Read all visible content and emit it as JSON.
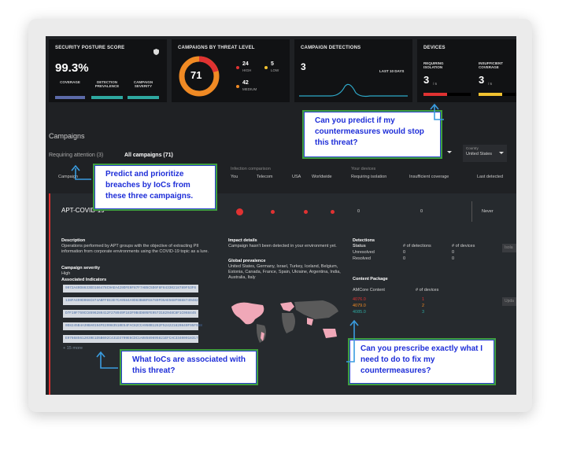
{
  "cards": {
    "posture": {
      "title": "SECURITY POSTURE SCORE",
      "value": "99.3%",
      "labels": [
        "COVERAGE",
        "DETECTION PREVALENCE",
        "CAMPAIGN SEVERITY"
      ]
    },
    "threat": {
      "title": "CAMPAIGNS BY THREAT LEVEL",
      "total": "71",
      "high": "24",
      "high_label": "HIGH",
      "low": "5",
      "low_label": "LOW",
      "medium": "42",
      "medium_label": "MEDIUM"
    },
    "detections": {
      "title": "CAMPAIGN DETECTIONS",
      "value": "3",
      "period": "LAST 10 DAYS"
    },
    "devices": {
      "title": "DEVICES",
      "iso_label": "REQUIRING ISOLATION",
      "iso_value": "3",
      "iso_total": "/ 6",
      "cov_label": "INSUFFICIENT COVERAGE",
      "cov_value": "3",
      "cov_total": "/ 6"
    }
  },
  "campaigns": {
    "title": "Campaigns",
    "tab_attention": "Requiring attention (3)",
    "tab_all": "All campaigns (71)",
    "country_label": "Country",
    "country_value": "United States",
    "col_campaign": "Campaign",
    "infection_comparison": "Infection comparison",
    "col_you": "You",
    "col_telecom": "Telecom",
    "col_usa": "USA",
    "col_worldwide": "Worldwide",
    "your_devices": "Your devices",
    "col_req_iso": "Requiring isolation",
    "col_insuff": "Insufficient coverage",
    "col_last": "Last detected",
    "row": {
      "name": "APT-COVID-19",
      "iso": "0",
      "cov": "0",
      "last": "Never"
    }
  },
  "details": {
    "desc_title": "Description",
    "desc": "Operations performed by APT groups with the objective of extracting PII information from corporate environments using the COVID-19 topic as a lure.",
    "severity_title": "Campaign severity",
    "severity": "High",
    "ioc_title": "Associated Indicators",
    "iocs": [
      "9972A49D8633ED166478C9AEA429DFE9F87F7AB5C5D6F8F84330218789F53F6",
      "138FA499D066C874ABFFEE3E7CA9584A9D83B8BFE8780FD6AE568F9888749482",
      "D7F19F759CC8596286412F278949F183F9B4D805FE9573182948C8F1C068445",
      "0D8245B4A39BA0194FE29983510E54FAC82CCA950B1262F524221820840F95F988",
      "E976685612039E1D5B692C431D3709E6CDC1A08589695821EFCAC33400918317"
    ],
    "more": "+ 15 more",
    "impact_title": "Impact details",
    "impact": "Campaign hasn't been detected in your environment yet.",
    "prevalence_title": "Global prevalence",
    "prevalence": "United States, Germany, Israel, Turkey, Iceland, Belgium, Estonia, Canada, France, Spain, Ukraine, Argentina, India, Australia, Italy",
    "detections_title": "Detections",
    "det_headers": [
      "Status",
      "# of detections",
      "# of devices"
    ],
    "det_rows": [
      [
        "Unresolved",
        "0",
        "0"
      ],
      [
        "Resolved",
        "0",
        "0"
      ]
    ],
    "content_title": "Content Package",
    "content_headers": [
      "AMCore Content",
      "# of devices"
    ],
    "content_rows": [
      [
        "4076.0",
        "1"
      ],
      [
        "4079.0",
        "2"
      ],
      [
        "4085.0",
        "3"
      ]
    ],
    "btn1": "Isola",
    "btn2": "Upda"
  },
  "callouts": {
    "predict": "Can you predict if my countermeasures would stop this threat?",
    "prioritize": "Predict and prioritize breaches by IoCs from these three campaigns.",
    "iocs": "What IoCs are associated with this threat?",
    "prescribe": "Can you prescribe exactly what I need to do to fix my countermeasures?"
  },
  "colors": {
    "accent_blue": "#1e2ed8",
    "callout_border": "#3f9f3f",
    "arrow": "#3a9ce0",
    "red": "#e03232",
    "teal": "#2ea8a0",
    "orange": "#f08a24",
    "yellow": "#f2c230"
  }
}
